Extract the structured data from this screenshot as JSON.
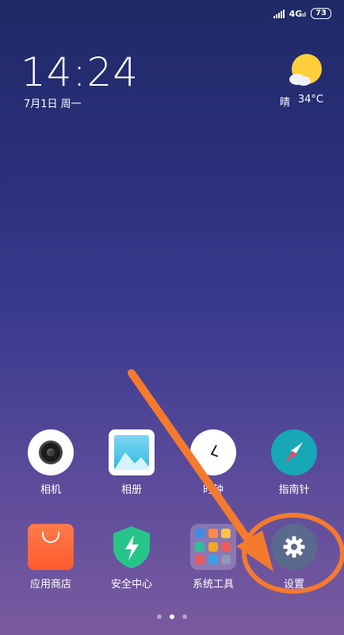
{
  "status_bar": {
    "network": "4G",
    "network_sub": "ıl",
    "battery": "73"
  },
  "clock": {
    "time": "14:24",
    "date": "7月1日 周一"
  },
  "weather": {
    "condition": "晴",
    "temperature": "34°C",
    "icon": "sun-cloud-icon"
  },
  "apps": [
    {
      "label": "相机",
      "icon": "camera-icon"
    },
    {
      "label": "相册",
      "icon": "gallery-icon"
    },
    {
      "label": "时钟",
      "icon": "clock-icon"
    },
    {
      "label": "指南针",
      "icon": "compass-icon"
    },
    {
      "label": "应用商店",
      "icon": "app-store-icon"
    },
    {
      "label": "安全中心",
      "icon": "security-center-icon"
    },
    {
      "label": "系统工具",
      "icon": "system-tools-folder-icon"
    },
    {
      "label": "设置",
      "icon": "settings-gear-icon"
    }
  ],
  "colors": {
    "annotation": "#f47a2d",
    "settings_bg": "#5a6a8c",
    "compass_bg": "#17a7b6",
    "security": "#27c48a",
    "store": "#ff6a3a"
  },
  "page_indicator": {
    "count": 3,
    "active": 2
  }
}
